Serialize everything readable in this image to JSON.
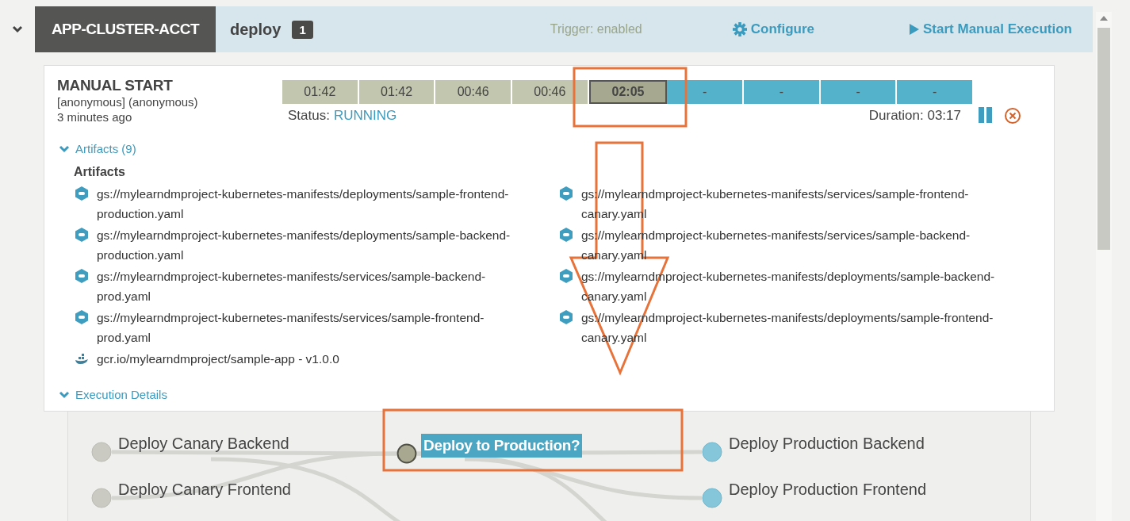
{
  "pipeline": {
    "name": "APP-CLUSTER-ACCT",
    "expanded": true
  },
  "header": {
    "title": "deploy",
    "count": "1",
    "trigger": "Trigger: enabled",
    "configure": "Configure",
    "start": "Start Manual Execution"
  },
  "execution": {
    "trigger_title": "MANUAL START",
    "user": "[anonymous] (anonymous)",
    "time": "3 minutes ago",
    "stages": [
      {
        "label": "01:42",
        "kind": "succeeded",
        "selected": false
      },
      {
        "label": "01:42",
        "kind": "succeeded",
        "selected": false
      },
      {
        "label": "00:46",
        "kind": "succeeded",
        "selected": false
      },
      {
        "label": "00:46",
        "kind": "succeeded",
        "selected": false
      },
      {
        "label": "02:05",
        "kind": "running",
        "selected": true
      },
      {
        "label": "-",
        "kind": "pending",
        "selected": false
      },
      {
        "label": "-",
        "kind": "pending",
        "selected": false
      },
      {
        "label": "-",
        "kind": "pending",
        "selected": false
      },
      {
        "label": "-",
        "kind": "pending",
        "selected": false
      }
    ],
    "status_label": "Status:",
    "status": "RUNNING",
    "duration": "Duration: 03:17"
  },
  "artifacts": {
    "toggle": "Artifacts (9)",
    "expanded": true,
    "heading": "Artifacts",
    "items": [
      {
        "kind": "manifest",
        "text": "gs://mylearndmproject-kubernetes-manifests/deployments/sample-frontend-production.yaml"
      },
      {
        "kind": "manifest",
        "text": "gs://mylearndmproject-kubernetes-manifests/deployments/sample-backend-production.yaml"
      },
      {
        "kind": "manifest",
        "text": "gs://mylearndmproject-kubernetes-manifests/services/sample-backend-prod.yaml"
      },
      {
        "kind": "manifest",
        "text": "gs://mylearndmproject-kubernetes-manifests/services/sample-frontend-prod.yaml"
      },
      {
        "kind": "image",
        "text": "gcr.io/mylearndmproject/sample-app - v1.0.0"
      },
      {
        "kind": "manifest",
        "text": "gs://mylearndmproject-kubernetes-manifests/services/sample-frontend-canary.yaml"
      },
      {
        "kind": "manifest",
        "text": "gs://mylearndmproject-kubernetes-manifests/services/sample-backend-canary.yaml"
      },
      {
        "kind": "manifest",
        "text": "gs://mylearndmproject-kubernetes-manifests/deployments/sample-backend-canary.yaml"
      },
      {
        "kind": "manifest",
        "text": "gs://mylearndmproject-kubernetes-manifests/deployments/sample-frontend-canary.yaml"
      }
    ]
  },
  "details": {
    "toggle": "Execution Details",
    "expanded": true
  },
  "graph": {
    "columns": [
      {
        "nodes": [
          {
            "label": "Deploy Canary Backend",
            "kind": "succeeded",
            "selected": false
          },
          {
            "label": "Deploy Canary Frontend",
            "kind": "succeeded",
            "selected": false
          }
        ]
      },
      {
        "nodes": [
          {
            "label": "Deploy to Production?",
            "kind": "running",
            "selected": true
          }
        ]
      },
      {
        "nodes": [
          {
            "label": "Deploy Production Backend",
            "kind": "pending",
            "selected": false
          },
          {
            "label": "Deploy Production Frontend",
            "kind": "pending",
            "selected": false
          }
        ]
      }
    ]
  }
}
